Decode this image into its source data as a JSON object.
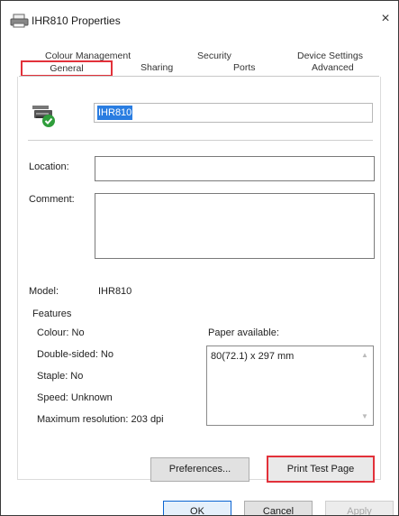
{
  "window": {
    "title": "IHR810 Properties",
    "close_label": "×"
  },
  "tabs": {
    "row1": [
      "Colour Management",
      "Security",
      "Device Settings"
    ],
    "row2": [
      "General",
      "Sharing",
      "Ports",
      "Advanced"
    ],
    "active": "General"
  },
  "general": {
    "printer_name": "IHR810",
    "location_label": "Location:",
    "location_value": "",
    "comment_label": "Comment:",
    "comment_value": "",
    "model_label": "Model:",
    "model_value": "IHR810"
  },
  "features": {
    "heading": "Features",
    "colour": "Colour: No",
    "double_sided": "Double-sided: No",
    "staple": "Staple: No",
    "speed": "Speed: Unknown",
    "max_resolution": "Maximum resolution: 203 dpi",
    "paper_label": "Paper available:",
    "paper_items": [
      "80(72.1) x 297 mm"
    ]
  },
  "buttons": {
    "preferences": "Preferences...",
    "print_test_page": "Print Test Page",
    "ok": "OK",
    "cancel": "Cancel",
    "apply": "Apply"
  },
  "colors": {
    "highlight_red": "#e2313a",
    "selection_blue": "#2a7de1",
    "default_button_blue": "#0a64d2"
  }
}
